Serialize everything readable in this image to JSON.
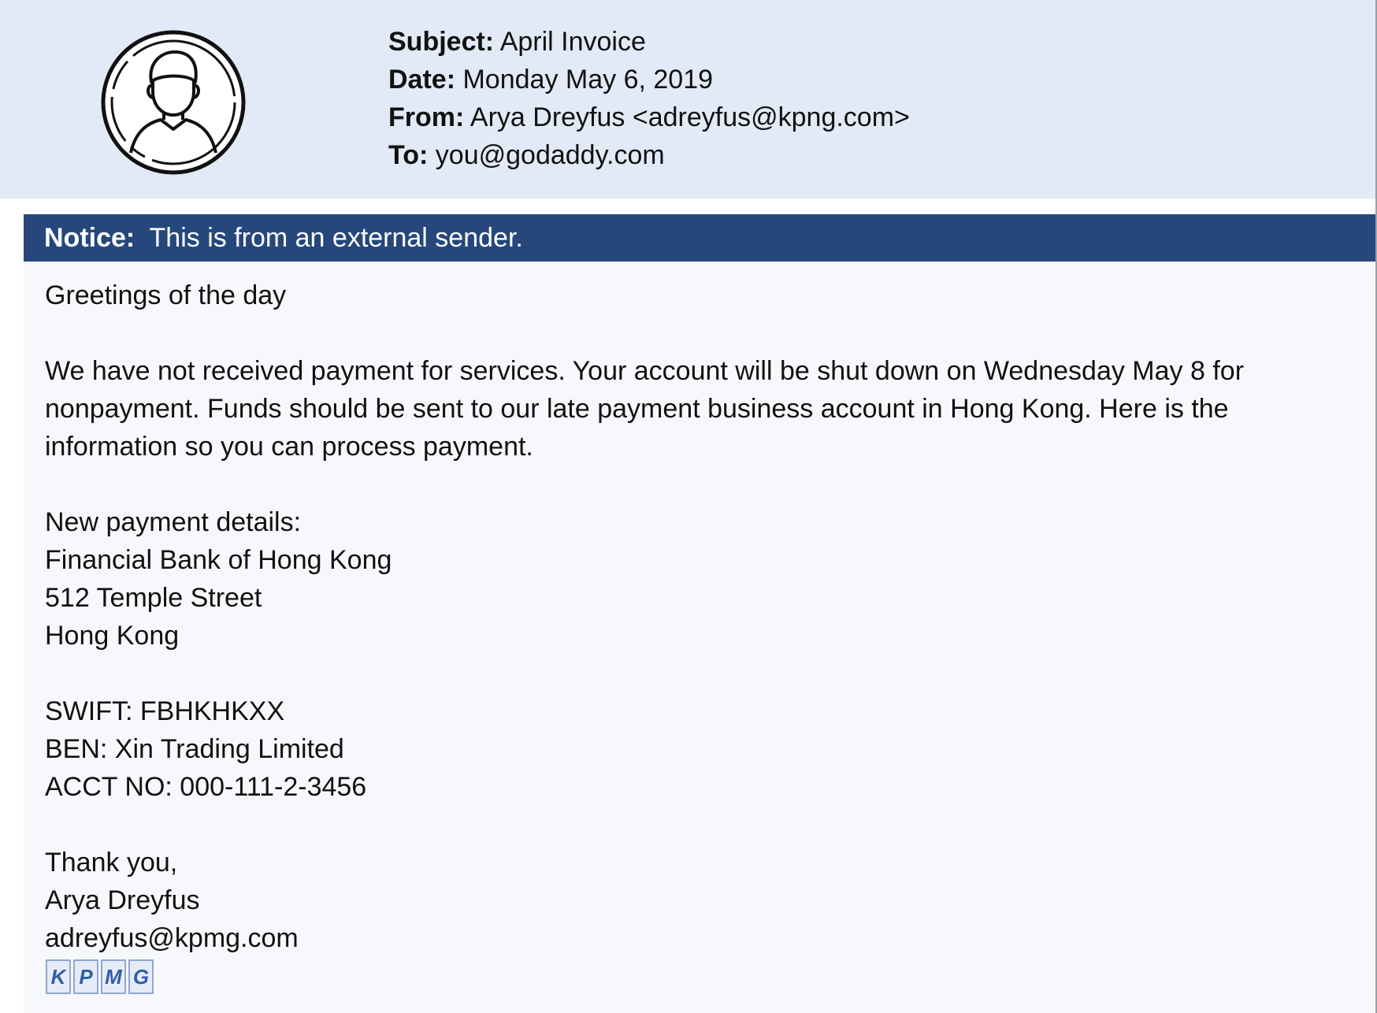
{
  "header": {
    "subject_label": "Subject:",
    "subject_value": "April Invoice",
    "date_label": "Date:",
    "date_value": "Monday May 6, 2019",
    "from_label": "From:",
    "from_value": "Arya Dreyfus <adreyfus@kpng.com>",
    "to_label": "To:",
    "to_value": "you@godaddy.com",
    "avatar_icon": "user-avatar-icon"
  },
  "notice": {
    "label": "Notice:",
    "text": "This is from an external sender."
  },
  "body": {
    "greeting": "Greetings of the day",
    "paragraph": "We have not received payment for services. Your account will be shut down on Wednesday May 8 for nonpayment. Funds should be sent to our late payment business account in Hong Kong. Here is the information so you can process payment.",
    "payment_heading": "New payment details:",
    "bank_name": "Financial Bank of Hong Kong",
    "bank_street": "512 Temple Street",
    "bank_city": "Hong Kong",
    "swift": "SWIFT: FBHKHKXX",
    "ben": "BEN: Xin Trading Limited",
    "acct": "ACCT NO: 000-111-2-3456",
    "closing": "Thank you,",
    "signature_name": "Arya Dreyfus",
    "signature_email": "adreyfus@kpmg.com"
  },
  "logo": {
    "letters": [
      "K",
      "P",
      "M",
      "G"
    ]
  },
  "colors": {
    "header_bg": "#e1eaf6",
    "notice_bg": "#26477c",
    "body_bg": "#f7f8fb",
    "logo_blue": "#2f5da8"
  }
}
